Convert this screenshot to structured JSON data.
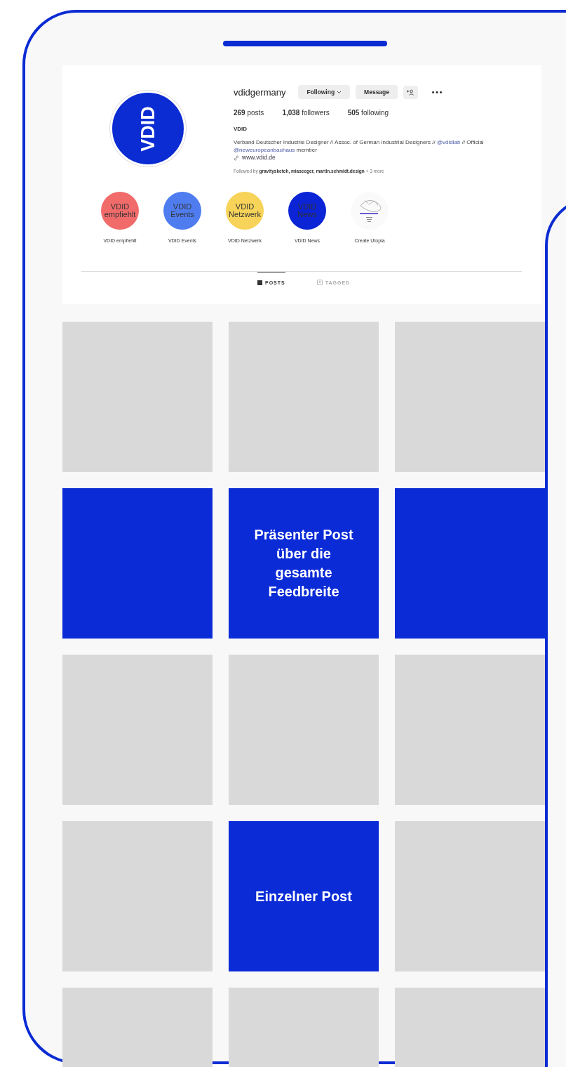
{
  "profile": {
    "avatar_text": "VDID",
    "username": "vdidgermany",
    "buttons": [
      {
        "kind": "dropdown",
        "label": "Following"
      },
      {
        "kind": "text",
        "label": "Message"
      },
      {
        "kind": "add-person"
      },
      {
        "kind": "more"
      }
    ],
    "stats": [
      {
        "value": "269",
        "label": "posts"
      },
      {
        "value": "1,038",
        "label": "followers"
      },
      {
        "value": "505",
        "label": "following"
      }
    ],
    "name": "VDID",
    "bio": [
      {
        "kind": "text",
        "text": "Verband Deutscher Industrie Designer // Assoc. of German Industrial Designers //"
      },
      {
        "kind": "mention",
        "text": "@vdidlab"
      },
      {
        "kind": "text",
        "text": "// Official"
      },
      {
        "kind": "mention",
        "text": "@neweuropeanbauhaus"
      },
      {
        "kind": "text",
        "text": "member"
      }
    ],
    "website": "www.vdid.de",
    "followed_by": "Followed by **gravitysketch, miaseeger, martin.schmidt.design** + 3 more"
  },
  "highlights": [
    {
      "label": "VDID empfiehlt",
      "cover": "VDID empfiehlt",
      "color": "#f26b6b"
    },
    {
      "label": "VDID Events",
      "cover": "VDID Events",
      "color": "#4f7df0"
    },
    {
      "label": "VDID Netzwerk",
      "cover": "VDID Netzwerk",
      "color": "#f7d35a"
    },
    {
      "label": "VDID News",
      "cover": "VDID News",
      "color": "#0a24d6"
    },
    {
      "label": "Create Utopia",
      "kind": "picture"
    }
  ],
  "tabs": [
    {
      "label": "POSTS",
      "selected": true
    },
    {
      "label": "TAGGED",
      "selected": false
    }
  ],
  "posts": [
    {
      "kind": "placeholder"
    },
    {
      "kind": "placeholder"
    },
    {
      "kind": "placeholder"
    },
    {
      "kind": "highlight"
    },
    {
      "kind": "highlight",
      "text": "Präsenter Post über die gesamte Feedbreite"
    },
    {
      "kind": "highlight"
    },
    {
      "kind": "placeholder"
    },
    {
      "kind": "placeholder"
    },
    {
      "kind": "placeholder"
    },
    {
      "kind": "placeholder"
    },
    {
      "kind": "highlight",
      "text": "Einzelner Post"
    },
    {
      "kind": "placeholder"
    },
    {
      "kind": "placeholder"
    },
    {
      "kind": "placeholder"
    },
    {
      "kind": "placeholder"
    }
  ]
}
